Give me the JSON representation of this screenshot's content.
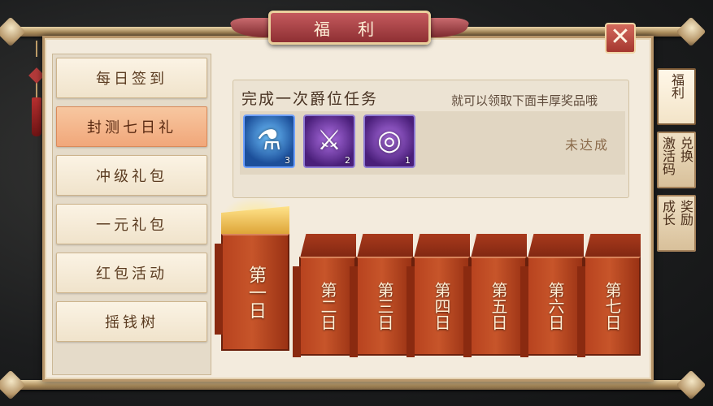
{
  "window": {
    "title": "福 利",
    "close_symbol": "✕"
  },
  "sidebar": {
    "items": [
      {
        "label": "每日签到",
        "active": false
      },
      {
        "label": "封测七日礼",
        "active": true
      },
      {
        "label": "冲级礼包",
        "active": false
      },
      {
        "label": "一元礼包",
        "active": false
      },
      {
        "label": "红包活动",
        "active": false
      },
      {
        "label": "摇钱树",
        "active": false
      }
    ]
  },
  "right_tabs": [
    {
      "col1": "福",
      "col2": "利",
      "active": true
    },
    {
      "col1": "激活码",
      "col2": "兑换",
      "active": false
    },
    {
      "col1": "成长",
      "col2": "奖励",
      "active": false
    }
  ],
  "task": {
    "title": "完成一次爵位任务",
    "description": "就可以领取下面丰厚奖品哦",
    "status": "未达成",
    "rewards": [
      {
        "icon": "potion-icon",
        "count": "3",
        "glyph": "⚗"
      },
      {
        "icon": "crossed-swords-icon",
        "count": "2",
        "glyph": "⚔"
      },
      {
        "icon": "purple-swirl-icon",
        "count": "1",
        "glyph": "◎"
      }
    ]
  },
  "days": [
    {
      "label": "第一日",
      "opened": true
    },
    {
      "label": "第二日",
      "opened": false
    },
    {
      "label": "第三日",
      "opened": false
    },
    {
      "label": "第四日",
      "opened": false
    },
    {
      "label": "第五日",
      "opened": false
    },
    {
      "label": "第六日",
      "opened": false
    },
    {
      "label": "第七日",
      "opened": false
    }
  ],
  "colors": {
    "panel_bg": "#f3ebdd",
    "active_tab": "#f1a77a",
    "day_red": "#b8431f",
    "title_red": "#8e2f33"
  }
}
